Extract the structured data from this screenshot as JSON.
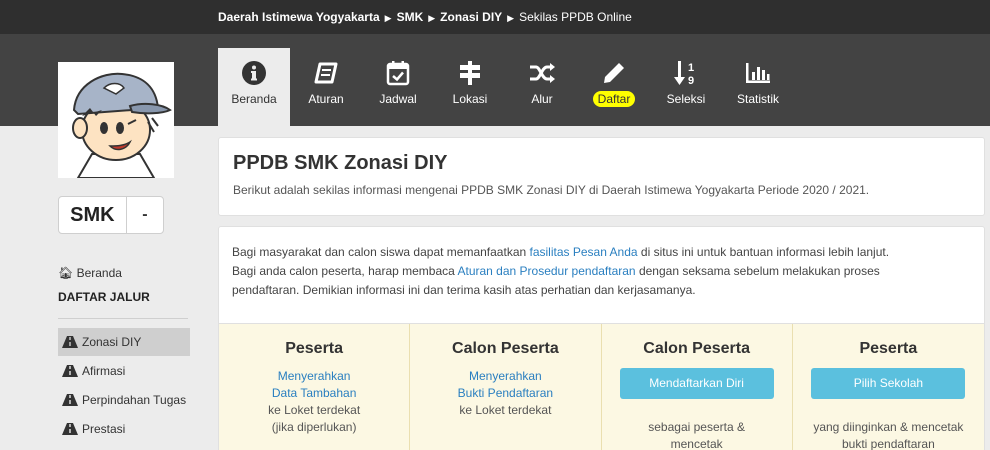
{
  "breadcrumb": {
    "items": [
      "Daerah Istimewa Yogyakarta",
      "SMK",
      "Zonasi DIY",
      "Sekilas PPDB Online"
    ]
  },
  "nav": {
    "tabs": [
      {
        "label": "Beranda",
        "icon": "info-circle-icon"
      },
      {
        "label": "Aturan",
        "icon": "book-icon"
      },
      {
        "label": "Jadwal",
        "icon": "calendar-check-icon"
      },
      {
        "label": "Lokasi",
        "icon": "signpost-icon"
      },
      {
        "label": "Alur",
        "icon": "random-icon"
      },
      {
        "label": "Daftar",
        "icon": "pencil-icon"
      },
      {
        "label": "Seleksi",
        "icon": "sort-numeric-icon"
      },
      {
        "label": "Statistik",
        "icon": "bar-chart-icon"
      }
    ],
    "active_index": 0,
    "highlight_index": 5
  },
  "level_select": {
    "value": "SMK"
  },
  "sidebar": {
    "home_label": "Beranda",
    "section_title": "DAFTAR JALUR",
    "items": [
      "Zonasi DIY",
      "Afirmasi",
      "Perpindahan Tugas",
      "Prestasi"
    ],
    "active_index": 0
  },
  "main": {
    "title": "PPDB SMK Zonasi DIY",
    "subtitle": "Berikut adalah sekilas informasi mengenai PPDB SMK Zonasi DIY di Daerah Istimewa Yogyakarta Periode 2020 / 2021.",
    "info": {
      "line1_a": "Bagi masyarakat dan calon siswa dapat memanfaatkan ",
      "line1_link": "fasilitas Pesan Anda",
      "line1_b": " di situs ini untuk bantuan informasi lebih lanjut.",
      "line2_a": "Bagi anda calon peserta, harap membaca ",
      "line2_link": "Aturan dan Prosedur pendaftaran",
      "line2_b": " dengan seksama sebelum melakukan proses",
      "line3": "pendaftaran. Demikian informasi ini dan terima kasih atas perhatian dan kerjasamanya."
    },
    "steps": [
      {
        "title": "Peserta",
        "blue1": "Menyerahkan",
        "blue2": "Data Tambahan",
        "txt1": "ke Loket terdekat",
        "txt2": "(jika diperlukan)"
      },
      {
        "title": "Calon Peserta",
        "blue1": "Menyerahkan",
        "blue2": "Bukti Pendaftaran",
        "txt1": "ke Loket terdekat"
      },
      {
        "title": "Calon Peserta",
        "button": "Mendaftarkan Diri",
        "txt1": "sebagai peserta &",
        "txt2": "mencetak"
      },
      {
        "title": "Peserta",
        "button": "Pilih Sekolah",
        "txt1": "yang diinginkan & mencetak",
        "txt2": "bukti pendaftaran"
      }
    ]
  },
  "colors": {
    "topbar": "#434343",
    "breadcrumb_bg": "#2f2f2f",
    "link": "#2a7fc0",
    "info_button": "#5bc0de",
    "steps_bg": "#fcf8e3",
    "highlight": "#ffff00"
  }
}
